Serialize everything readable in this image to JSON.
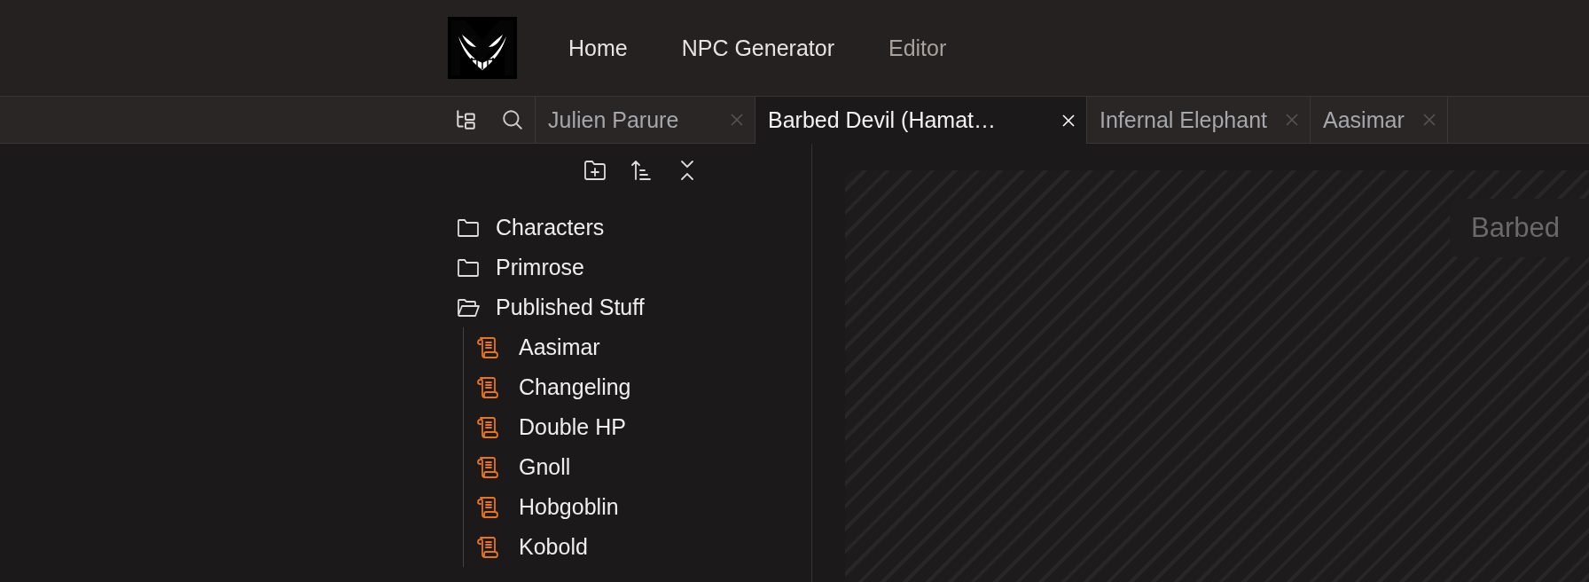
{
  "nav": [
    {
      "label": "Home",
      "selected": false
    },
    {
      "label": "NPC Generator",
      "selected": false
    },
    {
      "label": "Editor",
      "selected": true
    }
  ],
  "tabs": [
    {
      "label": "Julien Parure",
      "selected": false
    },
    {
      "label": "Barbed Devil (Hamat…",
      "selected": true
    },
    {
      "label": "Infernal Elephant",
      "selected": false
    },
    {
      "label": "Aasimar",
      "selected": false
    }
  ],
  "tree": [
    {
      "kind": "folder",
      "label": "Characters",
      "expanded": false
    },
    {
      "kind": "folder",
      "label": "Primrose",
      "expanded": false
    },
    {
      "kind": "folder",
      "label": "Published Stuff",
      "expanded": true,
      "children": [
        {
          "kind": "sheet",
          "label": "Aasimar"
        },
        {
          "kind": "sheet",
          "label": "Changeling"
        },
        {
          "kind": "sheet",
          "label": "Double HP"
        },
        {
          "kind": "sheet",
          "label": "Gnoll"
        },
        {
          "kind": "sheet",
          "label": "Hobgoblin"
        },
        {
          "kind": "sheet",
          "label": "Kobold"
        }
      ]
    }
  ],
  "canvas": {
    "title": "Barbed"
  }
}
